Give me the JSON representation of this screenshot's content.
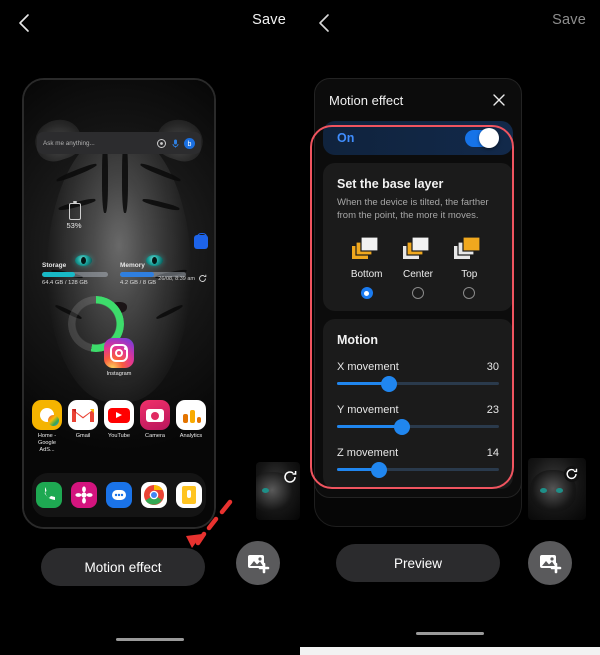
{
  "left_pane": {
    "topbar": {
      "back_icon": "chevron-left-icon",
      "save_label": "Save"
    },
    "home_screen": {
      "search": {
        "placeholder": "Ask me anything...",
        "icons": [
          "lens-icon",
          "microphone-icon",
          "bixby-icon"
        ]
      },
      "battery": {
        "percent_label": "53%",
        "percent": 53,
        "icon": "phone-battery-icon"
      },
      "storage": {
        "label": "Storage",
        "value": "64.4 GB / 128 GB",
        "fill_percent": 50
      },
      "memory": {
        "label": "Memory",
        "value": "4.2 GB / 8 GB",
        "fill_percent": 52
      },
      "timestamp": "26/08, 8:39 am",
      "refresh_icon": "refresh-icon",
      "cart_icon": "shopping-bag-icon",
      "featured_app": {
        "label": "Instagram",
        "icon": "instagram-icon"
      },
      "apps": [
        {
          "label": "Home - Google AdS...",
          "icon": "google-ads-icon"
        },
        {
          "label": "Gmail",
          "icon": "gmail-icon"
        },
        {
          "label": "YouTube",
          "icon": "youtube-icon"
        },
        {
          "label": "Camera",
          "icon": "camera-icon"
        },
        {
          "label": "Analytics",
          "icon": "google-analytics-icon"
        }
      ],
      "dock": [
        {
          "name": "Phone",
          "icon": "phone-icon"
        },
        {
          "name": "Contacts",
          "icon": "contacts-icon"
        },
        {
          "name": "Messages",
          "icon": "messages-icon"
        },
        {
          "name": "Chrome",
          "icon": "chrome-icon"
        },
        {
          "name": "Notes",
          "icon": "notes-icon"
        }
      ]
    },
    "motion_effect_button": "Motion effect",
    "add_image_button_icon": "add-image-icon",
    "thumbnail_refresh_icon": "refresh-icon",
    "annotation_arrow": "red-arrow-pointing-to-motion-effect"
  },
  "right_pane": {
    "topbar": {
      "back_icon": "chevron-left-icon",
      "save_label": "Save"
    },
    "motion_effect": {
      "title": "Motion effect",
      "close_icon": "close-icon",
      "toggle": {
        "label": "On",
        "state": true
      },
      "base_layer": {
        "heading": "Set the base layer",
        "description": "When the device is tilted, the farther from the point, the more it moves.",
        "options": [
          {
            "label": "Bottom",
            "selected": true,
            "icon": "layers-bottom-icon"
          },
          {
            "label": "Center",
            "selected": false,
            "icon": "layers-center-icon"
          },
          {
            "label": "Top",
            "selected": false,
            "icon": "layers-top-icon"
          }
        ]
      },
      "motion": {
        "heading": "Motion",
        "sliders": [
          {
            "label": "X movement",
            "value": 30,
            "position_percent": 32
          },
          {
            "label": "Y movement",
            "value": 23,
            "position_percent": 40
          },
          {
            "label": "Z movement",
            "value": 14,
            "position_percent": 26
          }
        ]
      }
    },
    "preview_button": "Preview",
    "add_image_button_icon": "add-image-icon",
    "thumbnail_refresh_icon": "refresh-icon"
  },
  "colors": {
    "accent_blue": "#2086ef",
    "toggle_blue": "#1673e8",
    "highlight_red": "#f0545f",
    "battery_green": "#3ddc6b",
    "layer_yellow": "#f0a81e"
  }
}
